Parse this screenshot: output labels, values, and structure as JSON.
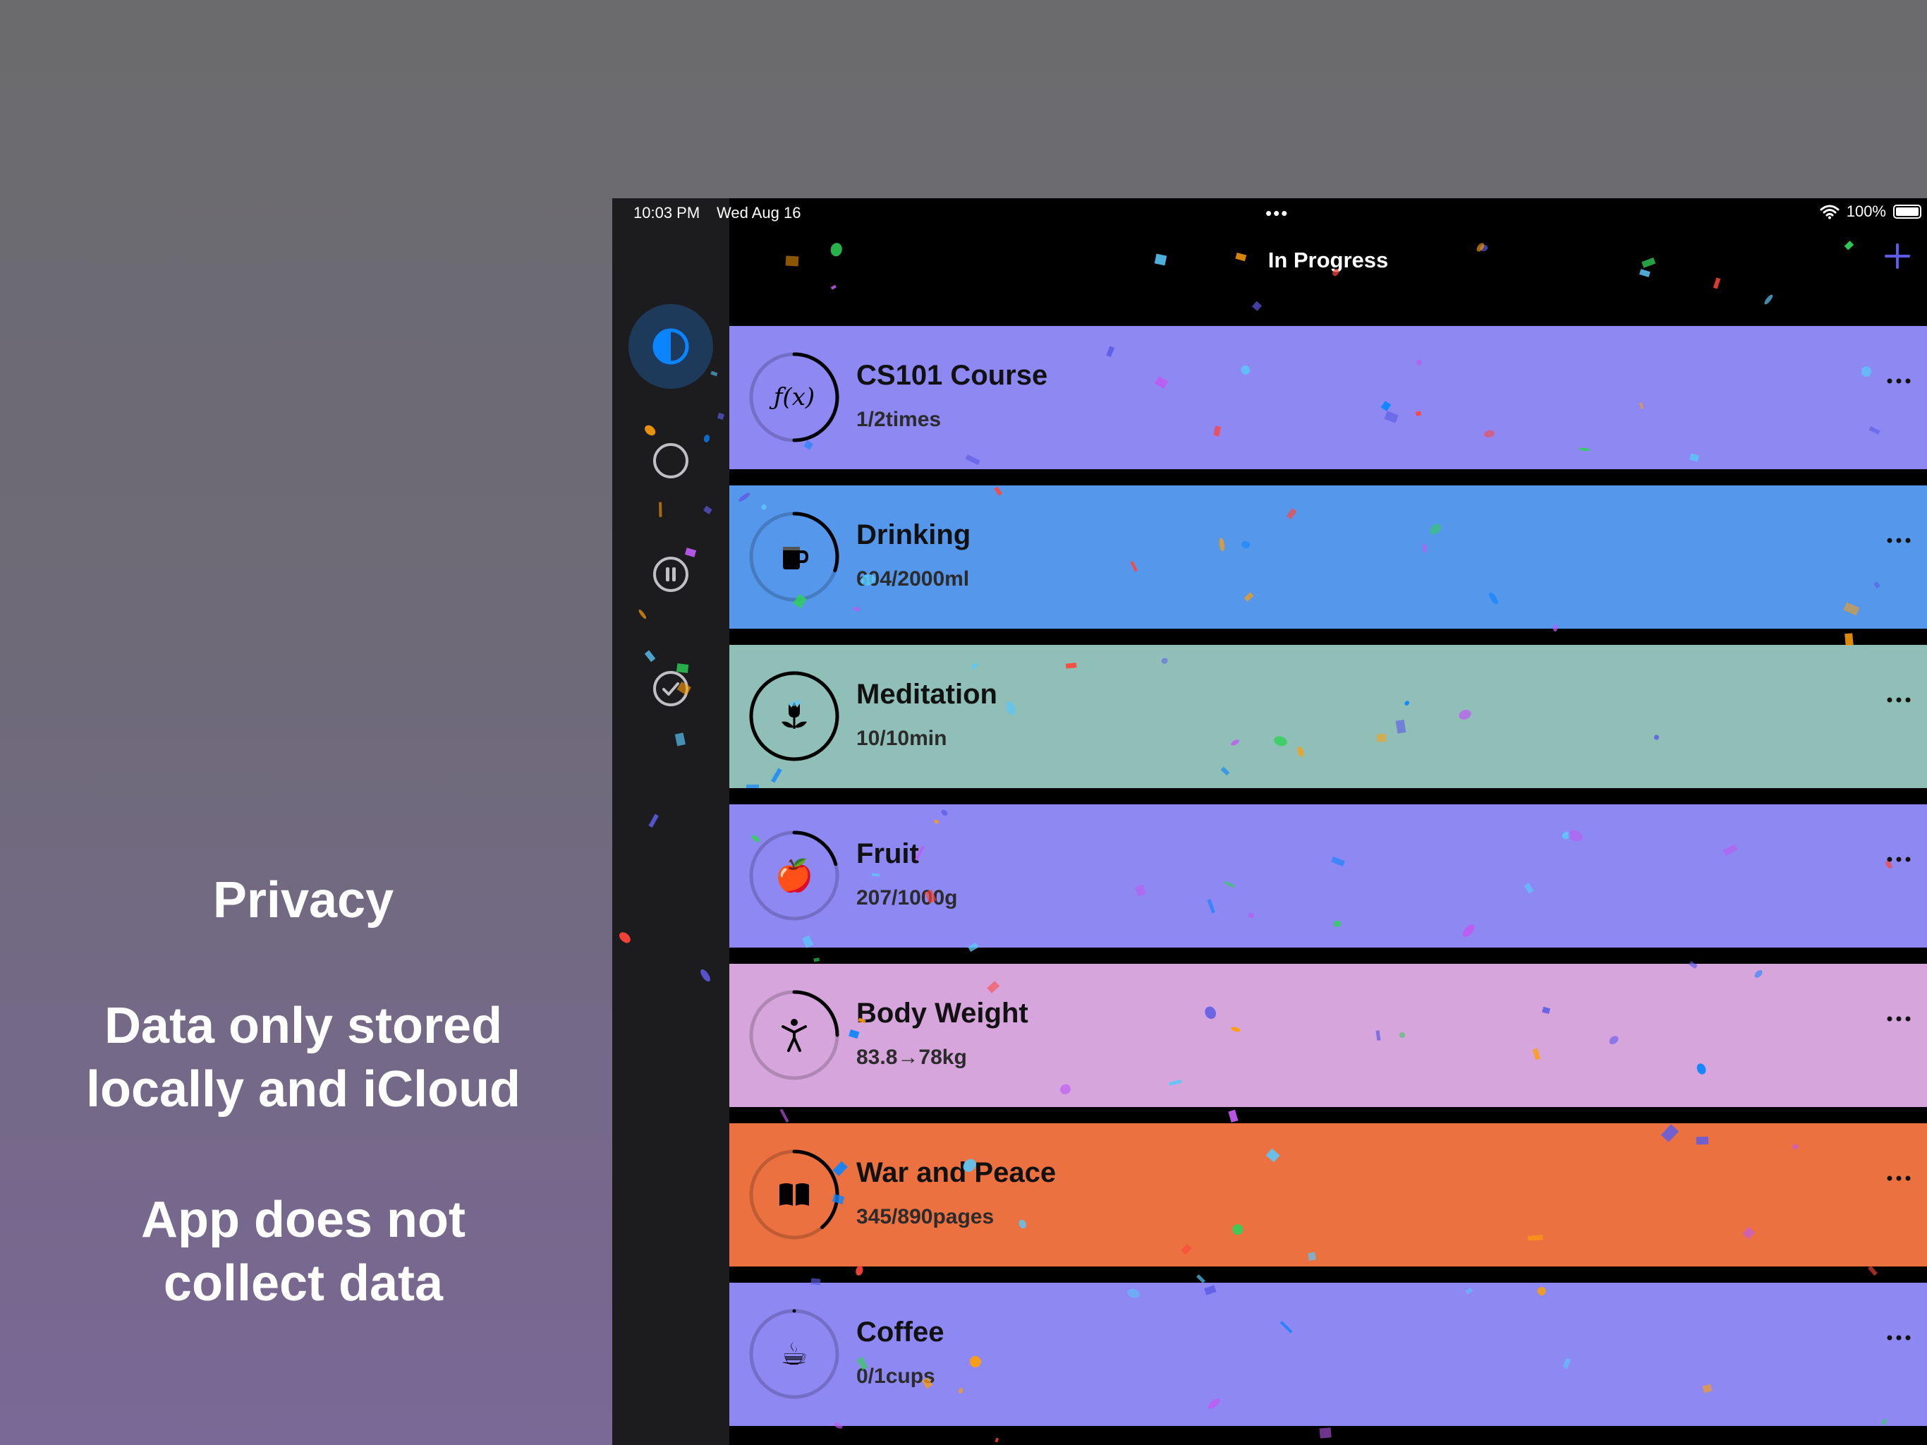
{
  "promo": {
    "line1": "Privacy",
    "line2a": "Data only stored",
    "line2b": "locally and iCloud",
    "line3a": "App does not",
    "line3b": "collect data"
  },
  "status_bar": {
    "time": "10:03 PM",
    "date": "Wed Aug 16",
    "dots": "•••",
    "battery": "100%"
  },
  "sidebar": {
    "items": [
      {
        "name": "all-filter",
        "icon": "half-circle-icon",
        "active": true
      },
      {
        "name": "in-progress-filter",
        "icon": "circle-icon",
        "active": false
      },
      {
        "name": "paused-filter",
        "icon": "pause-circle-icon",
        "active": false
      },
      {
        "name": "completed-filter",
        "icon": "checkmark-circle-icon",
        "active": false
      }
    ]
  },
  "nav": {
    "title": "In Progress",
    "add_icon": "plus-icon"
  },
  "colors": {
    "accent": "#5e5ce6",
    "active_icon": "#0a84ff"
  },
  "goals": [
    {
      "title": "CS101 Course",
      "progress_text": "1/2times",
      "icon": "function-icon",
      "icon_glyph": "ƒ(x)",
      "color": "#8e88f2",
      "progress": 0.5
    },
    {
      "title": "Drinking",
      "progress_text": "604/2000ml",
      "icon": "mug-icon",
      "icon_glyph": "",
      "color": "#5597ea",
      "progress": 0.302
    },
    {
      "title": "Meditation",
      "progress_text": "10/10min",
      "icon": "lotus-icon",
      "icon_glyph": "",
      "color": "#8fbfb6",
      "progress": 1.0
    },
    {
      "title": "Fruit",
      "progress_text": "207/1000g",
      "icon": "apple-icon",
      "icon_glyph": "🍎",
      "color": "#8e88f2",
      "progress": 0.207
    },
    {
      "title": "Body Weight",
      "progress_text": "83.8→78kg",
      "icon": "person-icon",
      "icon_glyph": "",
      "color": "#d6a5dc",
      "progress": 0.25
    },
    {
      "title": "War and Peace",
      "progress_text": "345/890pages",
      "icon": "book-icon",
      "icon_glyph": "",
      "color": "#eb7140",
      "progress": 0.388
    },
    {
      "title": "Coffee",
      "progress_text": "0/1cups",
      "icon": "coffee-cup-icon",
      "icon_glyph": "☕",
      "color": "#8e88f2",
      "progress": 0.0
    }
  ]
}
